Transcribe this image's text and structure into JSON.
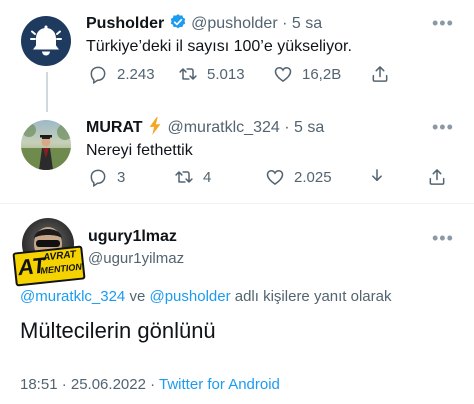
{
  "tweets": [
    {
      "display_name": "Pusholder",
      "handle": "@pusholder",
      "time": "· 5 sa",
      "text": "Türkiye’deki il sayısı 100’e yükseliyor.",
      "replies": "2.243",
      "retweets": "5.013",
      "likes": "16,2B"
    },
    {
      "display_name": "MURAT",
      "handle": "@muratklc_324",
      "time": "· 5 sa",
      "text": "Nereyi fethettik",
      "replies": "3",
      "retweets": "4",
      "likes": "2.025"
    }
  ],
  "main_tweet": {
    "display_name": "ugury1lmaz",
    "handle": "@ugur1yilmaz",
    "avatar_overlay_line1": "AVRAT",
    "avatar_overlay_big": "AT",
    "avatar_overlay_line2": "MENTION",
    "reply_to_mention1": "@muratklc_324",
    "reply_to_and": "ve",
    "reply_to_mention2": "@pusholder",
    "reply_to_suffix": "adlı kişilere yanıt olarak",
    "text": "Mültecilerin gönlünü",
    "timestamp": "18:51 · 25.06.2022 ·",
    "source": "Twitter for Android"
  },
  "colors": {
    "accent": "#1d9bf0",
    "muted": "#536471",
    "verified": "#1d9bf0",
    "bell_avatar_bg": "#1e3a5f",
    "bolt": "#f5a623"
  },
  "icons": [
    "bell-icon",
    "verified-icon",
    "lightning-icon",
    "reply-icon",
    "retweet-icon",
    "like-icon",
    "share-icon",
    "download-icon",
    "more-icon"
  ]
}
